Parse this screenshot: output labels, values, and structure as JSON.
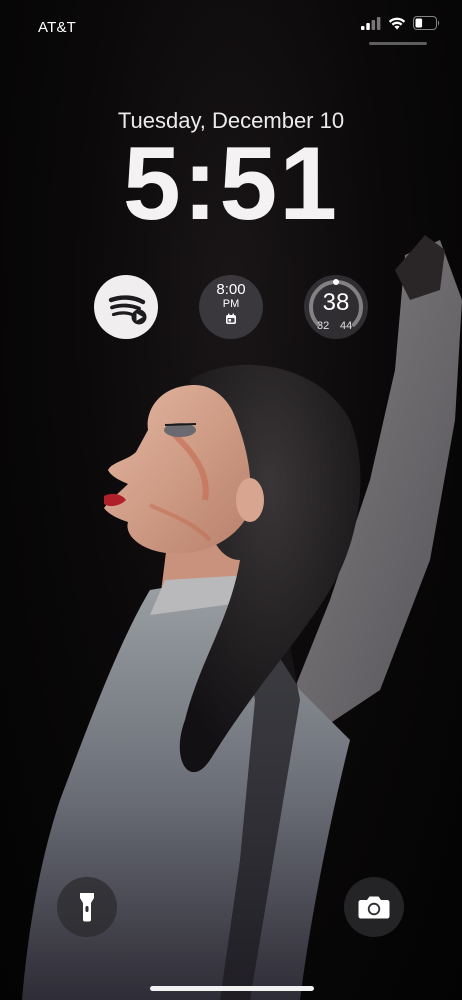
{
  "status_bar": {
    "carrier": "AT&T",
    "signal_icon": "cellular-signal-icon",
    "wifi_icon": "wifi-icon",
    "battery_icon": "battery-icon",
    "battery_level": 0.35
  },
  "lock_screen": {
    "date": "Tuesday, December 10",
    "time": "5:51"
  },
  "widgets": {
    "spotify": {
      "icon": "spotify-icon"
    },
    "alarm": {
      "time": "8:00",
      "ampm": "PM",
      "icon": "calendar-icon"
    },
    "weather": {
      "current": "38",
      "low": "32",
      "high": "44",
      "range_position": 0.5
    }
  },
  "controls": {
    "flashlight_icon": "flashlight-icon",
    "camera_icon": "camera-icon"
  },
  "colors": {
    "widget_light": "#f1eef0",
    "widget_dark": "#46444a",
    "spotify_glyph": "#1c1b1d"
  }
}
